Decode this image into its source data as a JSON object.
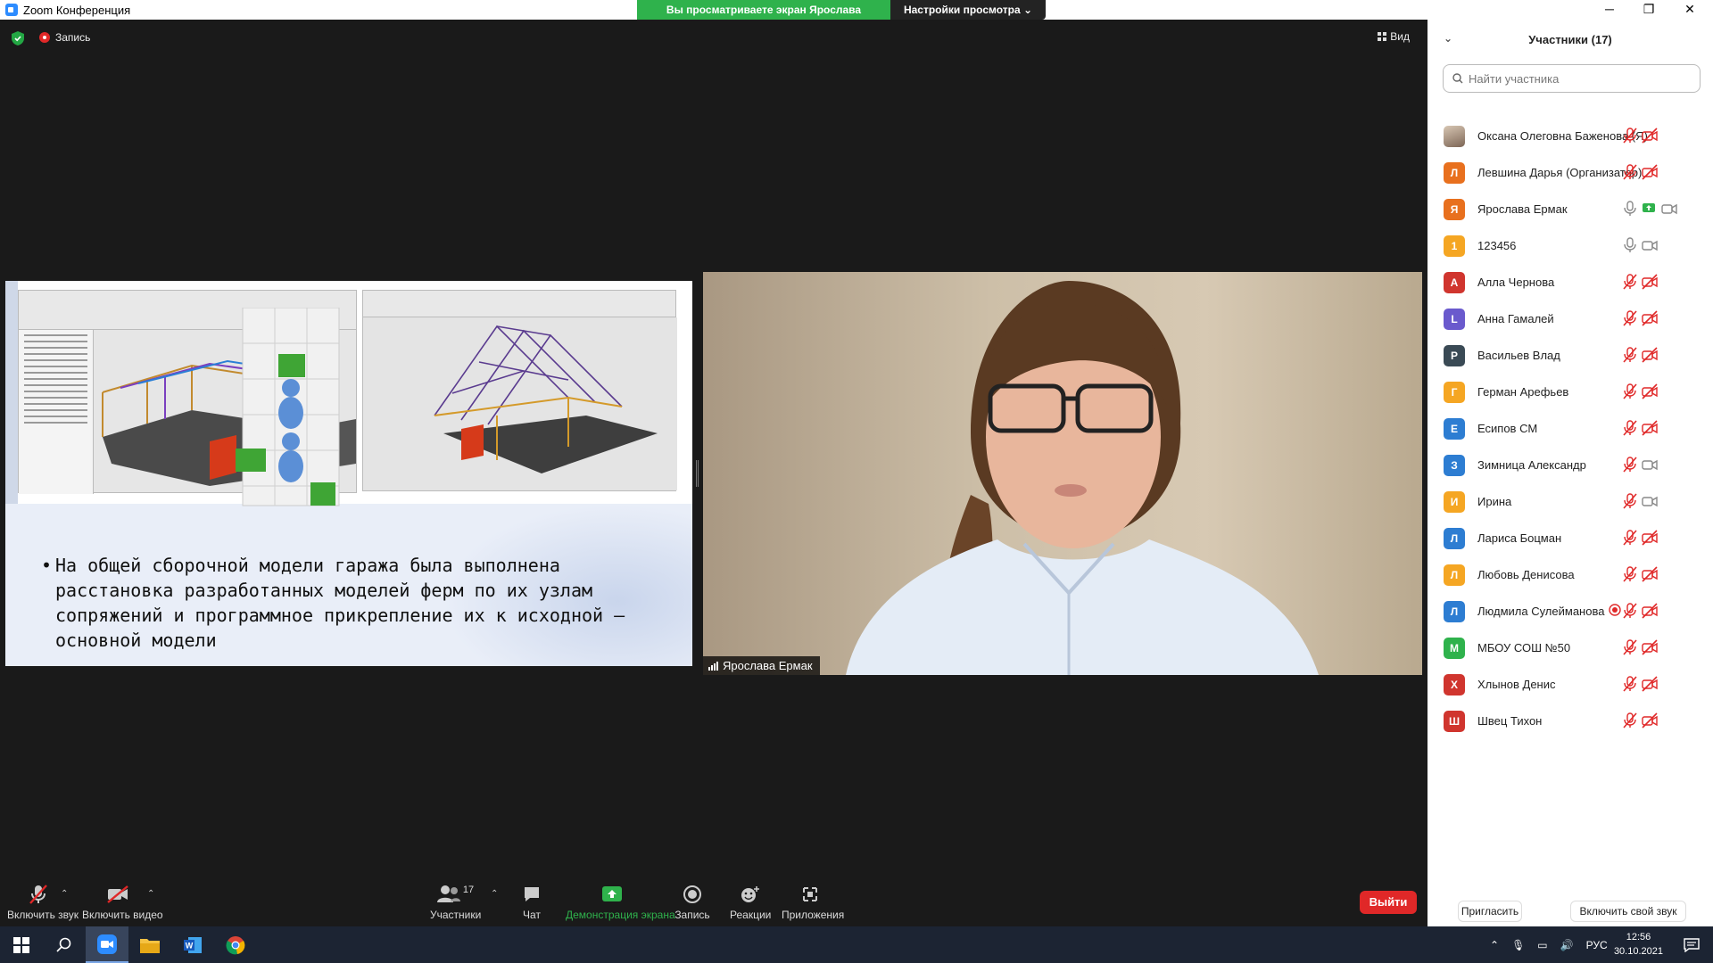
{
  "window": {
    "title": "Zoom Конференция",
    "share_banner": "Вы просматриваете экран Ярослава Ермак",
    "view_options": "Настройки просмотра",
    "controls": [
      "─",
      "❐",
      "✕"
    ]
  },
  "meeting": {
    "recording_label": "Запись",
    "view_label": "Вид"
  },
  "slide": {
    "text": "На общей сборочной модели гаража была выполнена расстановка разработанных моделей ферм по их узлам сопряжений и программное прикрепление их к исходной — основной модели"
  },
  "video": {
    "speaker_name": "Ярослава Ермак"
  },
  "toolbar": {
    "mute_label": "Включить звук",
    "video_label": "Включить видео",
    "participants_label": "Участники",
    "participants_count": "17",
    "chat_label": "Чат",
    "share_label": "Демонстрация экрана",
    "record_label": "Запись",
    "reactions_label": "Реакции",
    "apps_label": "Приложения",
    "leave_label": "Выйти"
  },
  "panel": {
    "title": "Участники (17)",
    "search_placeholder": "Найти участника",
    "invite_label": "Пригласить",
    "unmute_self_label": "Включить свой звук",
    "participants": [
      {
        "initial": "",
        "name": "Оксана Олеговна Баженова (Я)",
        "color": "#b0a090",
        "photo": true,
        "mic": "muted",
        "cam": "off"
      },
      {
        "initial": "Л",
        "name": "Левшина Дарья (Организатор)",
        "color": "#e8701e",
        "mic": "muted",
        "cam": "off"
      },
      {
        "initial": "Я",
        "name": "Ярослава Ермак",
        "color": "#e8701e",
        "mic": "on",
        "cam": "on",
        "sharing": true
      },
      {
        "initial": "1",
        "name": "123456",
        "color": "#f5a623",
        "mic": "on",
        "cam": "on"
      },
      {
        "initial": "А",
        "name": "Алла Чернова",
        "color": "#d0352e",
        "mic": "muted",
        "cam": "off"
      },
      {
        "initial": "L",
        "name": "Анна Гамалей",
        "color": "#6a5acd",
        "mic": "muted",
        "cam": "off"
      },
      {
        "initial": "Р",
        "name": "Васильев Влад",
        "color": "#3a4a55",
        "mic": "muted",
        "cam": "off"
      },
      {
        "initial": "Г",
        "name": "Герман Арефьев",
        "color": "#f5a623",
        "mic": "muted",
        "cam": "off"
      },
      {
        "initial": "Е",
        "name": "Есипов СМ",
        "color": "#2d7dd2",
        "mic": "muted",
        "cam": "off"
      },
      {
        "initial": "З",
        "name": "Зимница Александр",
        "color": "#2d7dd2",
        "mic": "muted",
        "cam": "on"
      },
      {
        "initial": "И",
        "name": "Ирина",
        "color": "#f5a623",
        "mic": "muted",
        "cam": "on"
      },
      {
        "initial": "Л",
        "name": "Лариса Боцман",
        "color": "#2d7dd2",
        "mic": "muted",
        "cam": "off"
      },
      {
        "initial": "Л",
        "name": "Любовь Денисова",
        "color": "#f5a623",
        "mic": "muted",
        "cam": "off"
      },
      {
        "initial": "Л",
        "name": "Людмила Сулейманова",
        "color": "#2d7dd2",
        "mic": "muted",
        "cam": "off",
        "recording": true
      },
      {
        "initial": "М",
        "name": "МБОУ СОШ №50",
        "color": "#2fb24c",
        "mic": "muted",
        "cam": "off"
      },
      {
        "initial": "Х",
        "name": "Хлынов Денис",
        "color": "#d0352e",
        "mic": "muted",
        "cam": "off"
      },
      {
        "initial": "Ш",
        "name": "Швец Тихон",
        "color": "#d0352e",
        "mic": "muted",
        "cam": "off"
      }
    ]
  },
  "taskbar": {
    "language": "РУС",
    "time": "12:56",
    "date": "30.10.2021"
  },
  "colors": {
    "accent": "#2d8cff",
    "share_green": "#2fb24c",
    "leave_red": "#e02828",
    "muted_red": "#e02828"
  }
}
